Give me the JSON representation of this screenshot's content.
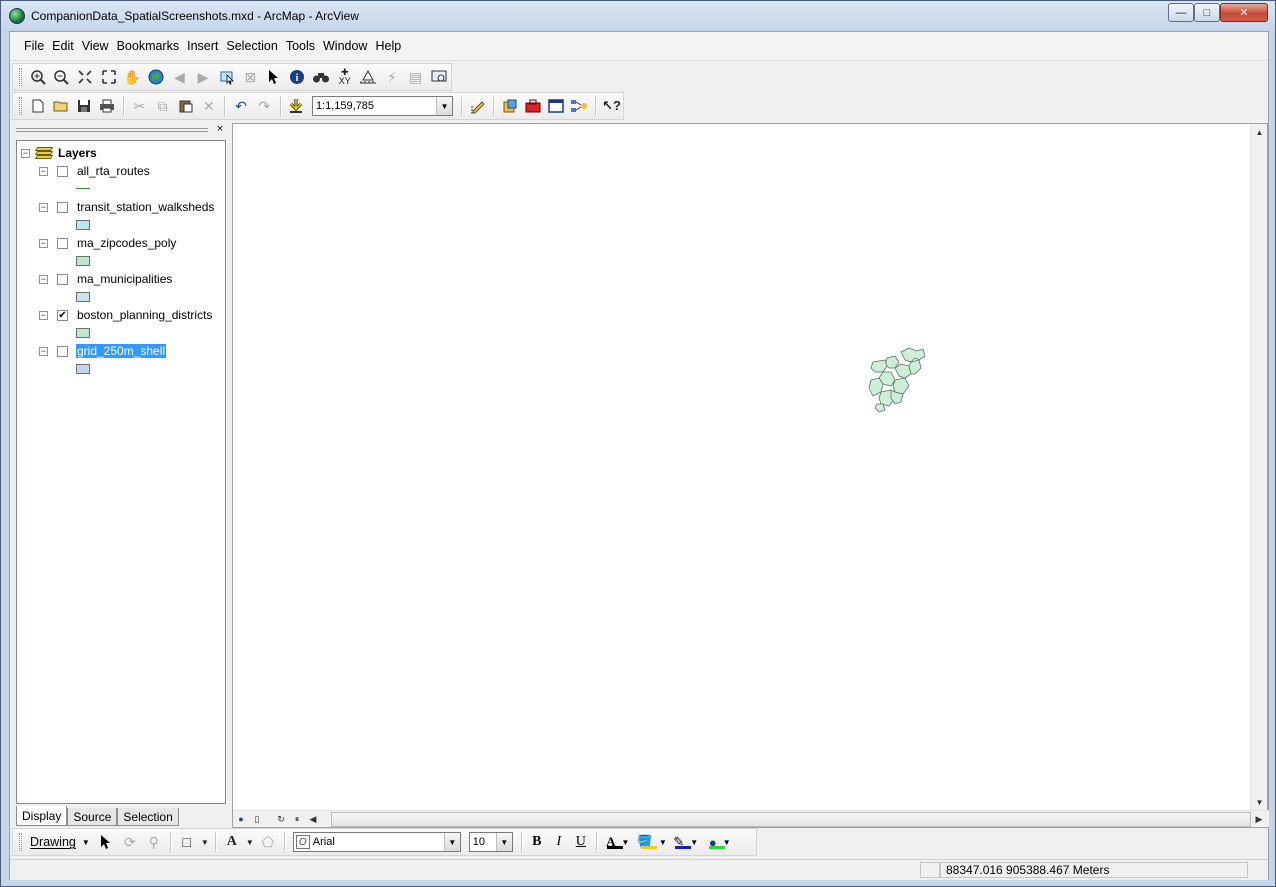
{
  "window": {
    "title": "CompanionData_SpatialScreenshots.mxd - ArcMap - ArcView",
    "controls": {
      "minimize": "—",
      "maximize": "□",
      "close": "✕"
    }
  },
  "menu": [
    "File",
    "Edit",
    "View",
    "Bookmarks",
    "Insert",
    "Selection",
    "Tools",
    "Window",
    "Help"
  ],
  "tools_toolbar": {
    "icons": [
      "zoom-in-icon",
      "zoom-out-icon",
      "fixed-zoom-in-icon",
      "fixed-zoom-out-icon",
      "pan-icon",
      "full-extent-icon",
      "back-icon",
      "forward-icon",
      "select-features-icon",
      "clear-selection-icon",
      "select-elements-icon",
      "identify-icon",
      "find-icon",
      "go-to-xy-icon",
      "measure-icon",
      "hyperlink-icon",
      "html-popup-icon",
      "time-slider-icon"
    ]
  },
  "standard_toolbar": {
    "icons": [
      "new-icon",
      "open-icon",
      "save-icon",
      "print-icon",
      "cut-icon",
      "copy-icon",
      "paste-icon",
      "delete-icon",
      "undo-icon",
      "redo-icon",
      "add-data-icon"
    ],
    "map_scale": "1:1,159,785",
    "trailing_icons": [
      "editor-toolbar-icon",
      "arccatalog-icon",
      "arctoolbox-icon",
      "python-window-icon",
      "modelbuilder-icon",
      "whats-this-icon"
    ]
  },
  "toc": {
    "close_glyph": "×",
    "root": {
      "label": "Layers",
      "expander": "−"
    },
    "layers": [
      {
        "name": "all_rta_routes",
        "checked": false,
        "symbol": "line",
        "color": "#2f8a2f",
        "expander": "−"
      },
      {
        "name": "transit_station_walksheds",
        "checked": false,
        "symbol": "fill",
        "color": "#b8e8ee",
        "expander": "−"
      },
      {
        "name": "ma_zipcodes_poly",
        "checked": false,
        "symbol": "fill",
        "color": "#bfe6c8",
        "expander": "−"
      },
      {
        "name": "ma_municipalities",
        "checked": false,
        "symbol": "fill",
        "color": "#c6e3f0",
        "expander": "−"
      },
      {
        "name": "boston_planning_districts",
        "checked": true,
        "symbol": "fill",
        "color": "#c4e7cf",
        "expander": "−"
      },
      {
        "name": "grid_250m_shell",
        "checked": false,
        "symbol": "fill",
        "color": "#c3d6ee",
        "expander": "−",
        "selected": true
      }
    ],
    "tabs": [
      "Display",
      "Source",
      "Selection"
    ],
    "active_tab": "Display"
  },
  "map": {
    "feature_color": "#cdeed8",
    "feature_outline": "#5f6f66"
  },
  "drawing_toolbar": {
    "label": "Drawing",
    "font_name": "Arial",
    "font_size": "10",
    "bold": "B",
    "italic": "I",
    "underline": "U",
    "font_color": "#000000",
    "fill_color": "#f2c81c",
    "line_color": "#1c1cc0",
    "marker_color": "#3cd23c"
  },
  "status": {
    "coordinates": "88347.016  905388.467 Meters"
  }
}
